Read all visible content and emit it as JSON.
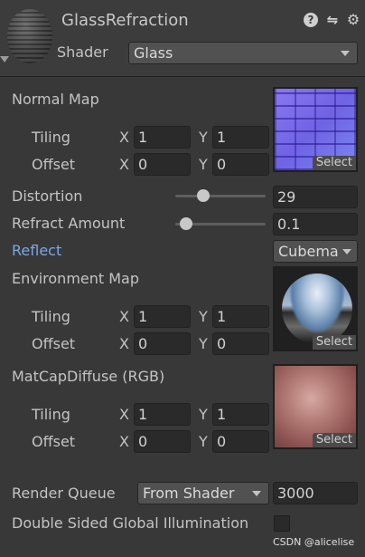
{
  "header": {
    "title": "GlassRefraction",
    "shader_label": "Shader",
    "shader_value": "Glass",
    "icons": [
      "help-icon",
      "preset-icon",
      "gear-icon"
    ]
  },
  "normal_map": {
    "label": "Normal Map",
    "tiling_label": "Tiling",
    "offset_label": "Offset",
    "tiling_x": "1",
    "tiling_y": "1",
    "offset_x": "0",
    "offset_y": "0",
    "select_label": "Select"
  },
  "distortion": {
    "label": "Distortion",
    "value": "29",
    "slider_fraction": 0.29
  },
  "refract_amount": {
    "label": "Refract Amount",
    "value": "0.1",
    "slider_fraction": 0.1
  },
  "reflect": {
    "label": "Reflect",
    "value": "Cubema"
  },
  "environment_map": {
    "label": "Environment Map",
    "tiling_label": "Tiling",
    "offset_label": "Offset",
    "tiling_x": "1",
    "tiling_y": "1",
    "offset_x": "0",
    "offset_y": "0",
    "select_label": "Select"
  },
  "matcap": {
    "label": "MatCapDiffuse (RGB)",
    "tiling_label": "Tiling",
    "offset_label": "Offset",
    "tiling_x": "1",
    "tiling_y": "1",
    "offset_x": "0",
    "offset_y": "0",
    "select_label": "Select"
  },
  "axis_labels": {
    "x": "X",
    "y": "Y"
  },
  "render_queue": {
    "label": "Render Queue",
    "mode": "From Shader",
    "value": "3000"
  },
  "double_sided_gi": {
    "label": "Double Sided Global Illumination",
    "checked": false
  },
  "watermark": "CSDN @alicelise",
  "colors": {
    "background": "#383838",
    "header_bg": "#3c3c3c",
    "text": "#c4c4c4",
    "field_bg": "#2a2a2a",
    "link": "#7aa8e6"
  }
}
